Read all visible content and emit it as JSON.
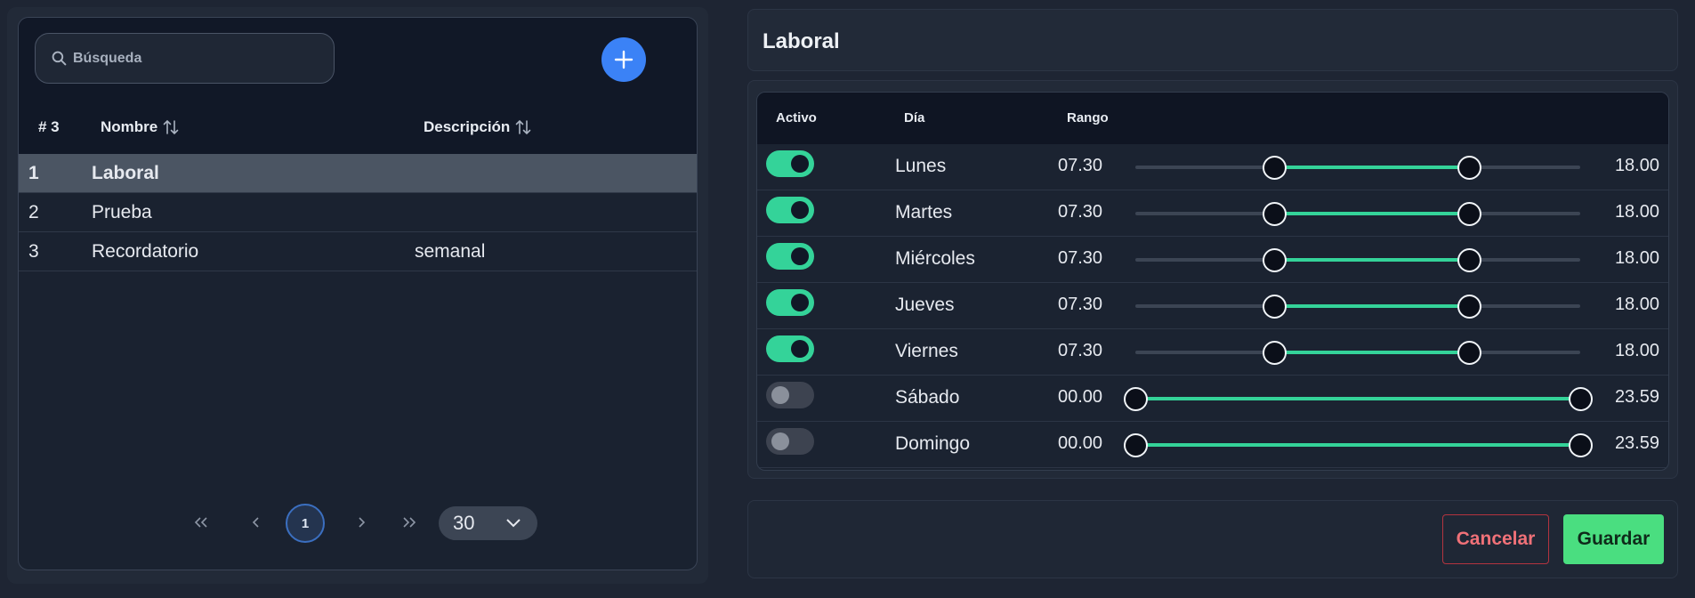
{
  "list": {
    "search_placeholder": "Búsqueda",
    "add_icon": "plus-icon",
    "columns": {
      "count": "# 3",
      "name": "Nombre",
      "description": "Descripción"
    },
    "rows": [
      {
        "num": "1",
        "name": "Laboral",
        "description": "",
        "selected": true
      },
      {
        "num": "2",
        "name": "Prueba",
        "description": ""
      },
      {
        "num": "3",
        "name": "Recordatorio",
        "description": "semanal"
      }
    ],
    "pagination": {
      "first": "«",
      "prev": "‹",
      "current": "1",
      "next": "›",
      "last": "»",
      "per_page": "30"
    }
  },
  "detail": {
    "title": "Laboral",
    "columns": {
      "active": "Activo",
      "day": "Día",
      "range": "Rango"
    },
    "days": [
      {
        "day": "Lunes",
        "active": true,
        "start": "07.30",
        "end": "18.00",
        "start_frac": 0.3125,
        "end_frac": 0.75
      },
      {
        "day": "Martes",
        "active": true,
        "start": "07.30",
        "end": "18.00",
        "start_frac": 0.3125,
        "end_frac": 0.75
      },
      {
        "day": "Miércoles",
        "active": true,
        "start": "07.30",
        "end": "18.00",
        "start_frac": 0.3125,
        "end_frac": 0.75
      },
      {
        "day": "Jueves",
        "active": true,
        "start": "07.30",
        "end": "18.00",
        "start_frac": 0.3125,
        "end_frac": 0.75
      },
      {
        "day": "Viernes",
        "active": true,
        "start": "07.30",
        "end": "18.00",
        "start_frac": 0.3125,
        "end_frac": 0.75
      },
      {
        "day": "Sábado",
        "active": false,
        "start": "00.00",
        "end": "23.59",
        "start_frac": 0,
        "end_frac": 1
      },
      {
        "day": "Domingo",
        "active": false,
        "start": "00.00",
        "end": "23.59",
        "start_frac": 0,
        "end_frac": 1
      }
    ]
  },
  "actions": {
    "cancel": "Cancelar",
    "save": "Guardar"
  },
  "colors": {
    "accent_green": "#34d399",
    "accent_blue": "#3b82f6",
    "danger": "#f07178"
  }
}
